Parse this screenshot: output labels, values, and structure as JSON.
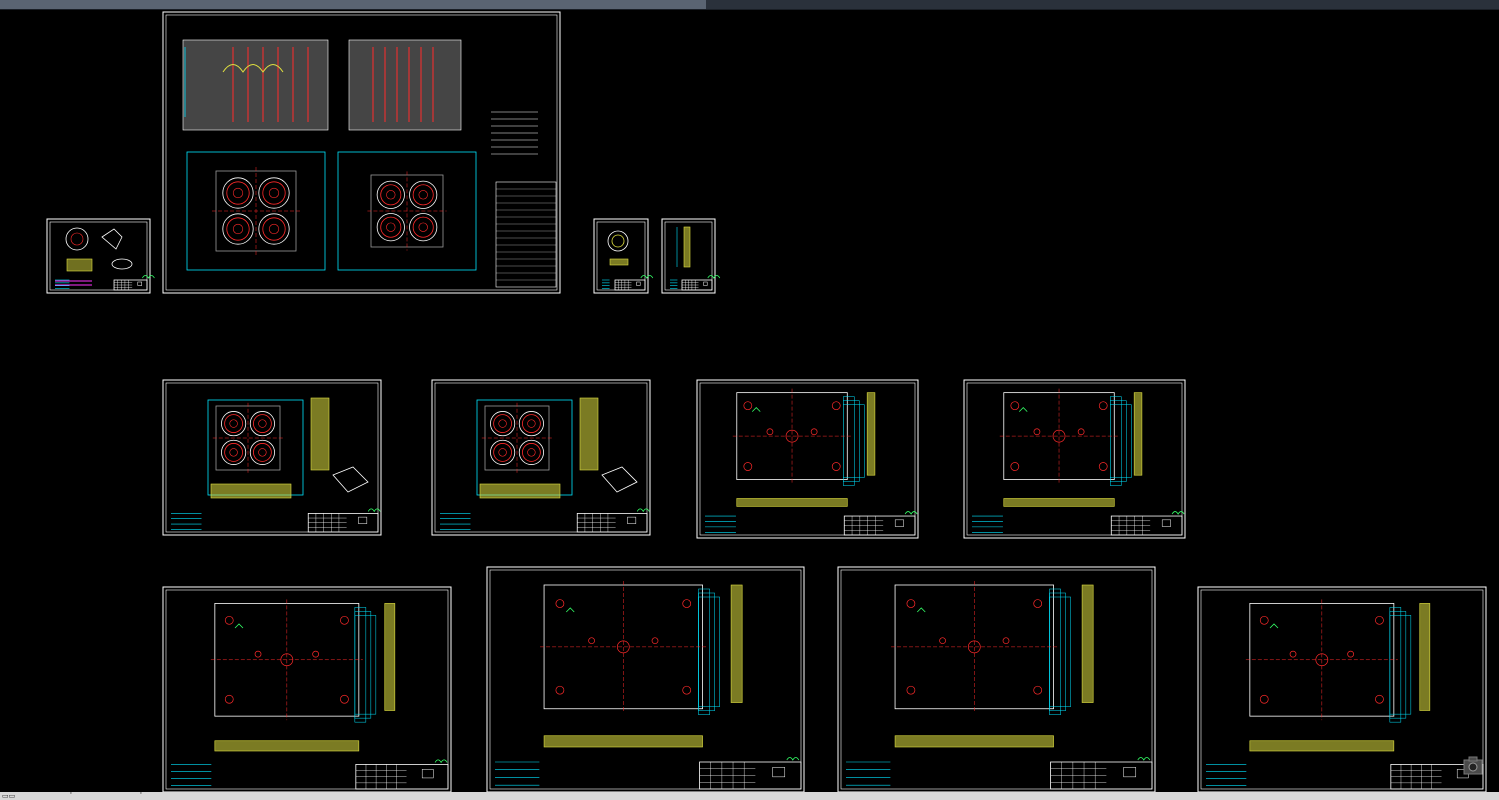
{
  "app": {
    "canvas_background": "#000000",
    "frame_color": "#ffffff",
    "colors": {
      "cyan": "#00e5ff",
      "red": "#ff2a2a",
      "yellow": "#e0e040",
      "green": "#33ff66",
      "magenta": "#ff33ff",
      "gray": "#9a9a9a",
      "white": "#ffffff"
    }
  },
  "status_bar": {
    "items": [
      "▭▭",
      "ﾟ",
      "ﾟ"
    ]
  },
  "sheets": [
    {
      "id": "assembly",
      "type": "assembly"
    },
    {
      "id": "part-product",
      "type": "part"
    },
    {
      "id": "part-ring",
      "type": "small"
    },
    {
      "id": "part-pin",
      "type": "small-tall"
    },
    {
      "id": "cavity-plate",
      "type": "cavity"
    },
    {
      "id": "core-plate",
      "type": "cavity"
    },
    {
      "id": "runner-plate",
      "type": "plate"
    },
    {
      "id": "support-plate",
      "type": "plate"
    },
    {
      "id": "top-clamp-plate",
      "type": "plate"
    },
    {
      "id": "ejector-plate",
      "type": "plate"
    },
    {
      "id": "ejector-retainer",
      "type": "plate"
    },
    {
      "id": "bottom-clamp-plate",
      "type": "plate"
    }
  ],
  "viewport": {
    "controls_icon": "camera-icon"
  }
}
